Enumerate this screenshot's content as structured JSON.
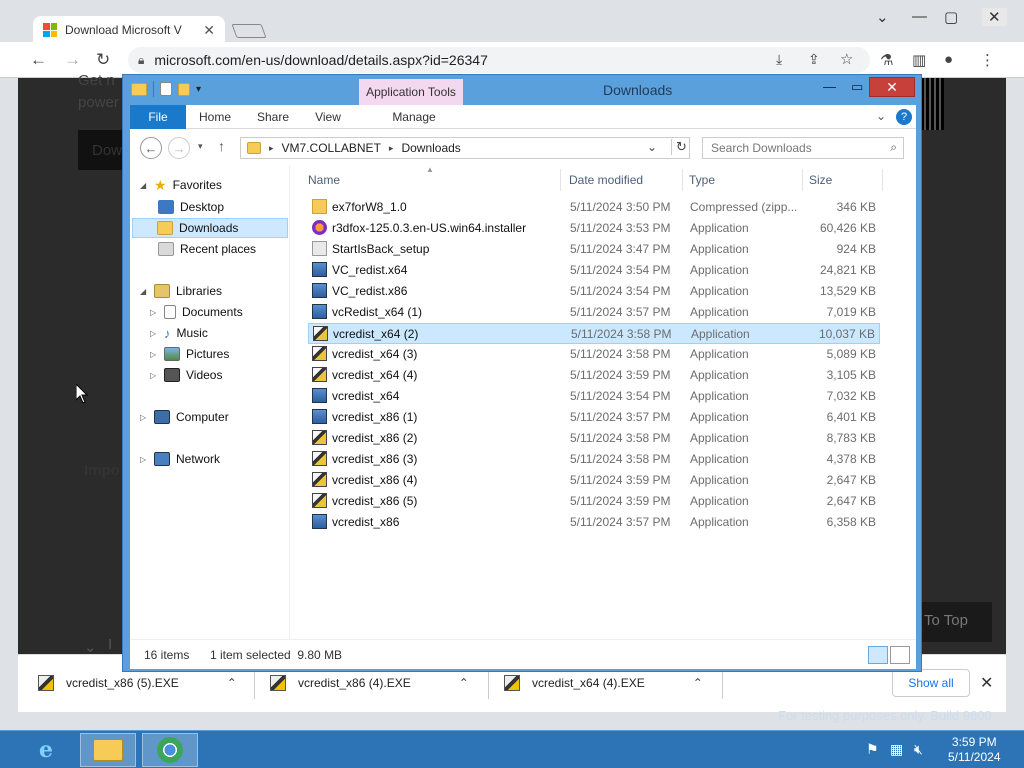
{
  "browser": {
    "tab_title": "Download Microsoft V",
    "url": "microsoft.com/en-us/download/details.aspx?id=26347",
    "page_fragments": {
      "get": "Get n",
      "power": "power",
      "dow": "Dow",
      "impo": "Impo",
      "i": "I",
      "to_top": "To Top"
    }
  },
  "download_bar": {
    "items": [
      {
        "name": "vcredist_x86 (5).EXE"
      },
      {
        "name": "vcredist_x86 (4).EXE"
      },
      {
        "name": "vcredist_x64 (4).EXE"
      }
    ],
    "show_all": "Show all"
  },
  "explorer": {
    "title": "Downloads",
    "context_tab": "Application Tools",
    "ribbon_tabs": [
      "File",
      "Home",
      "Share",
      "View",
      "Manage"
    ],
    "address": {
      "root": "VM7.COLLABNET",
      "current": "Downloads"
    },
    "search_placeholder": "Search Downloads",
    "nav": {
      "favorites": "Favorites",
      "desktop": "Desktop",
      "downloads": "Downloads",
      "recent": "Recent places",
      "libraries": "Libraries",
      "documents": "Documents",
      "music": "Music",
      "pictures": "Pictures",
      "videos": "Videos",
      "computer": "Computer",
      "network": "Network"
    },
    "columns": {
      "name": "Name",
      "date": "Date modified",
      "type": "Type",
      "size": "Size"
    },
    "files": [
      {
        "name": "ex7forW8_1.0",
        "date": "5/11/2024 3:50 PM",
        "type": "Compressed (zipp...",
        "size": "346 KB",
        "icon": "zip"
      },
      {
        "name": "r3dfox-125.0.3.en-US.win64.installer",
        "date": "5/11/2024 3:53 PM",
        "type": "Application",
        "size": "60,426 KB",
        "icon": "ff"
      },
      {
        "name": "StartIsBack_setup",
        "date": "5/11/2024 3:47 PM",
        "type": "Application",
        "size": "924 KB",
        "icon": "sib"
      },
      {
        "name": "VC_redist.x64",
        "date": "5/11/2024 3:54 PM",
        "type": "Application",
        "size": "24,821 KB",
        "icon": "vc"
      },
      {
        "name": "VC_redist.x86",
        "date": "5/11/2024 3:54 PM",
        "type": "Application",
        "size": "13,529 KB",
        "icon": "vc"
      },
      {
        "name": "vcRedist_x64 (1)",
        "date": "5/11/2024 3:57 PM",
        "type": "Application",
        "size": "7,019 KB",
        "icon": "vc"
      },
      {
        "name": "vcredist_x64 (2)",
        "date": "5/11/2024 3:58 PM",
        "type": "Application",
        "size": "10,037 KB",
        "icon": "app",
        "selected": true
      },
      {
        "name": "vcredist_x64 (3)",
        "date": "5/11/2024 3:58 PM",
        "type": "Application",
        "size": "5,089 KB",
        "icon": "app"
      },
      {
        "name": "vcredist_x64 (4)",
        "date": "5/11/2024 3:59 PM",
        "type": "Application",
        "size": "3,105 KB",
        "icon": "app"
      },
      {
        "name": "vcredist_x64",
        "date": "5/11/2024 3:54 PM",
        "type": "Application",
        "size": "7,032 KB",
        "icon": "vc"
      },
      {
        "name": "vcredist_x86 (1)",
        "date": "5/11/2024 3:57 PM",
        "type": "Application",
        "size": "6,401 KB",
        "icon": "vc"
      },
      {
        "name": "vcredist_x86 (2)",
        "date": "5/11/2024 3:58 PM",
        "type": "Application",
        "size": "8,783 KB",
        "icon": "app"
      },
      {
        "name": "vcredist_x86 (3)",
        "date": "5/11/2024 3:58 PM",
        "type": "Application",
        "size": "4,378 KB",
        "icon": "app"
      },
      {
        "name": "vcredist_x86 (4)",
        "date": "5/11/2024 3:59 PM",
        "type": "Application",
        "size": "2,647 KB",
        "icon": "app"
      },
      {
        "name": "vcredist_x86 (5)",
        "date": "5/11/2024 3:59 PM",
        "type": "Application",
        "size": "2,647 KB",
        "icon": "app"
      },
      {
        "name": "vcredist_x86",
        "date": "5/11/2024 3:57 PM",
        "type": "Application",
        "size": "6,358 KB",
        "icon": "vc"
      }
    ],
    "status": {
      "count": "16 items",
      "selection": "1 item selected  9.80 MB"
    }
  },
  "desktop": {
    "watermark": "For testing purposes only. Build 9600"
  },
  "taskbar": {
    "time": "3:59 PM",
    "date": "5/11/2024"
  }
}
